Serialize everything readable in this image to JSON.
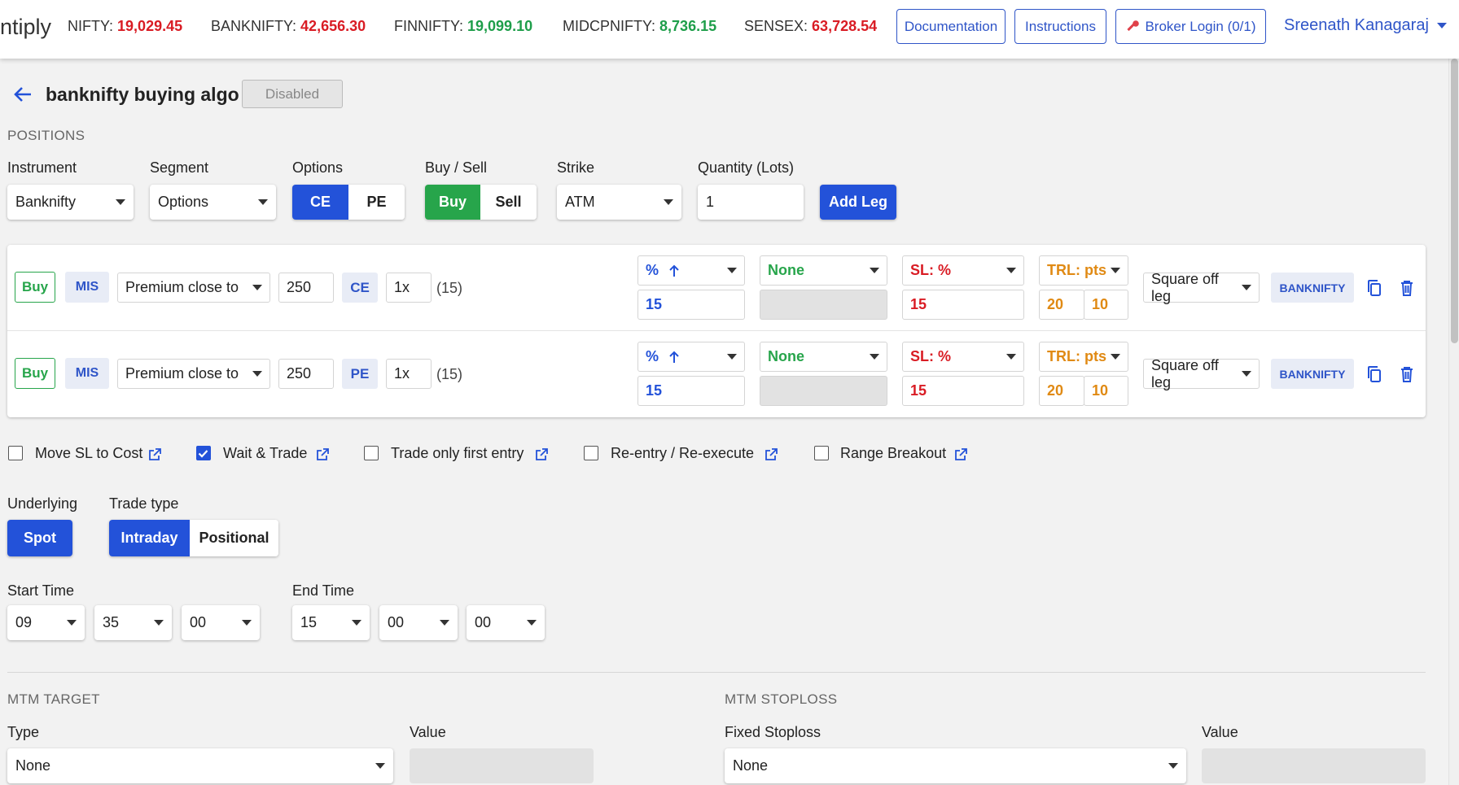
{
  "header": {
    "brand": "ntiply",
    "tickers": [
      {
        "name": "NIFTY:",
        "value": "19,029.45",
        "color": "#d91c24"
      },
      {
        "name": "BANKNIFTY:",
        "value": "42,656.30",
        "color": "#d91c24"
      },
      {
        "name": "FINNIFTY:",
        "value": "19,099.10",
        "color": "#1e9e4a"
      },
      {
        "name": "MIDCPNIFTY:",
        "value": "8,736.15",
        "color": "#1e9e4a"
      },
      {
        "name": "SENSEX:",
        "value": "63,728.54",
        "color": "#d91c24"
      }
    ],
    "documentation": "Documentation",
    "instructions": "Instructions",
    "broker_login": "Broker Login (0/1)",
    "user": "Sreenath Kanagaraj"
  },
  "strategy": {
    "title": "banknifty buying algo",
    "status": "Disabled"
  },
  "positions": {
    "section": "POSITIONS",
    "instrument_label": "Instrument",
    "instrument": "Banknifty",
    "segment_label": "Segment",
    "segment": "Options",
    "options_label": "Options",
    "ce": "CE",
    "pe": "PE",
    "buysell_label": "Buy / Sell",
    "buy": "Buy",
    "sell": "Sell",
    "strike_label": "Strike",
    "strike": "ATM",
    "qty_label": "Quantity (Lots)",
    "qty": "1",
    "add_leg": "Add Leg"
  },
  "legs": [
    {
      "side": "Buy",
      "product": "MIS",
      "selection": "Premium close to",
      "premium": "250",
      "opt": "CE",
      "mult": "1x",
      "lot": "(15)",
      "target_type": "%",
      "target": "15",
      "trail": "None",
      "sl_type": "SL: %",
      "sl": "15",
      "trl_type": "TRL: pts",
      "trl_x": "20",
      "trl_y": "10",
      "action": "Square off leg",
      "symbol": "BANKNIFTY"
    },
    {
      "side": "Buy",
      "product": "MIS",
      "selection": "Premium close to",
      "premium": "250",
      "opt": "PE",
      "mult": "1x",
      "lot": "(15)",
      "target_type": "%",
      "target": "15",
      "trail": "None",
      "sl_type": "SL: %",
      "sl": "15",
      "trl_type": "TRL: pts",
      "trl_x": "20",
      "trl_y": "10",
      "action": "Square off leg",
      "symbol": "BANKNIFTY"
    }
  ],
  "options": {
    "move_sl": "Move SL to Cost",
    "wait_trade": "Wait & Trade",
    "first_entry": "Trade only first entry",
    "reentry": "Re-entry / Re-execute",
    "range_breakout": "Range Breakout"
  },
  "underlying": {
    "label": "Underlying",
    "spot": "Spot"
  },
  "trade_type": {
    "label": "Trade type",
    "intraday": "Intraday",
    "positional": "Positional"
  },
  "start_time": {
    "label": "Start Time",
    "h": "09",
    "m": "35",
    "s": "00"
  },
  "end_time": {
    "label": "End Time",
    "h": "15",
    "m": "00",
    "s": "00"
  },
  "mtm_target": {
    "section": "MTM TARGET",
    "type_label": "Type",
    "type": "None",
    "value_label": "Value"
  },
  "mtm_stoploss": {
    "section": "MTM STOPLOSS",
    "type_label": "Fixed Stoploss",
    "type": "None",
    "value_label": "Value"
  }
}
